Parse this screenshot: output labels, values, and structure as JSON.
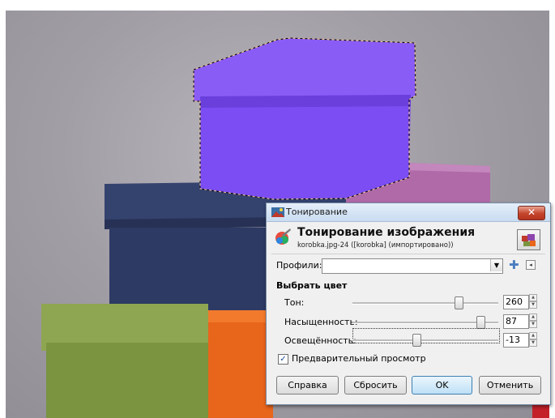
{
  "dialog": {
    "window_title": "Тонирование",
    "close_glyph": "✕",
    "header_title": "Тонирование изображения",
    "header_subtitle": "korobka.jpg-24 ([korobka] (импортировано))",
    "profiles_label": "Профили:",
    "profiles_value": "",
    "add_glyph": "✚",
    "menu_glyph": "◂",
    "section_title": "Выбрать цвет",
    "sliders": [
      {
        "label": "Тон:",
        "value": "260",
        "min": 0,
        "max": 360,
        "fraction": 0.72
      },
      {
        "label": "Насыщенность:",
        "value": "87",
        "min": 0,
        "max": 100,
        "fraction": 0.87
      },
      {
        "label": "Освещённость:",
        "value": "-13",
        "min": -100,
        "max": 100,
        "fraction": 0.435
      }
    ],
    "preview_checkbox": {
      "label": "Предварительный просмотр",
      "checked": true,
      "check_glyph": "✓"
    },
    "buttons": {
      "help": "Справка",
      "reset": "Сбросить",
      "ok": "OK",
      "cancel": "Отменить"
    }
  },
  "icons": {
    "app": "gimp-image-icon",
    "header": "colorize-tool-icon",
    "preview": "image-preview-icon",
    "add": "plus-icon",
    "menu": "collapse-menu-icon"
  },
  "colors": {
    "selected_box": "#7b4df2",
    "navy_box": "#2d3a63",
    "pink_box": "#b06aa8",
    "green_box": "#7a9440",
    "orange_box": "#e8651c",
    "background": "#a7a3aa",
    "ok_button_border": "#3c7fb1"
  }
}
